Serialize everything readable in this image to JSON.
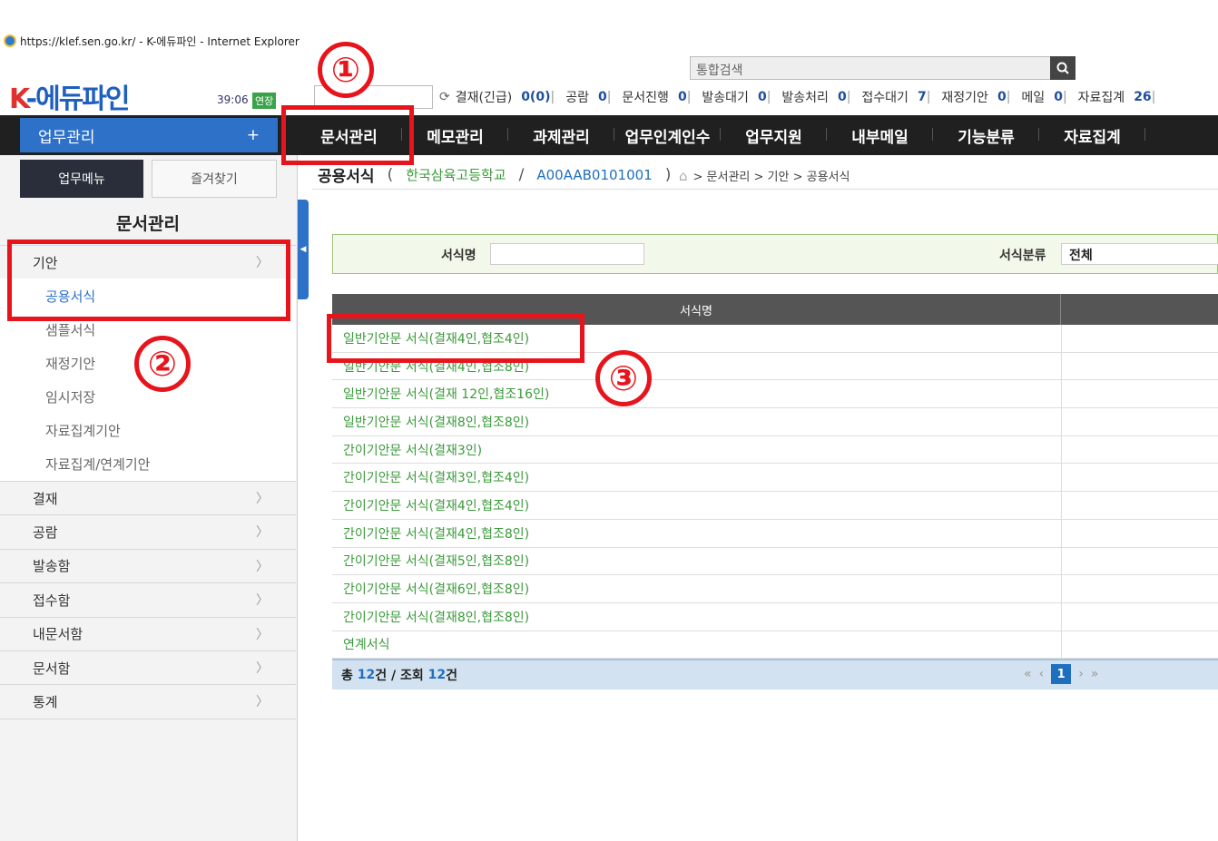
{
  "window": {
    "title": "https://klef.sen.go.kr/ - K-에듀파인 - Internet Explorer"
  },
  "header": {
    "logo": "K-에듀파인",
    "logo_k": "K",
    "logo_rest": "-에듀파인",
    "clock": "39:06",
    "extend_label": "연장",
    "search_placeholder": "통합검색",
    "status": [
      {
        "label": "결재(긴급)",
        "value": "0(0)"
      },
      {
        "label": "공람",
        "value": "0"
      },
      {
        "label": "문서진행",
        "value": "0"
      },
      {
        "label": "발송대기",
        "value": "0"
      },
      {
        "label": "발송처리",
        "value": "0"
      },
      {
        "label": "접수대기",
        "value": "7"
      },
      {
        "label": "재정기안",
        "value": "0"
      },
      {
        "label": "메일",
        "value": "0"
      },
      {
        "label": "자료집계",
        "value": "26"
      }
    ]
  },
  "leftnav": {
    "work_label": "업무관리",
    "plus": "+"
  },
  "topnav": [
    "문서관리",
    "메모관리",
    "과제관리",
    "업무인계인수",
    "업무지원",
    "내부메일",
    "기능분류",
    "자료집계"
  ],
  "sidebar": {
    "tab_menu": "업무메뉴",
    "tab_fav": "즐겨찾기",
    "title": "문서관리",
    "group_open": "기안",
    "sub_items": [
      "공용서식",
      "샘플서식",
      "재정기안",
      "임시저장",
      "자료집계기안",
      "자료집계/연계기안"
    ],
    "groups": [
      "결재",
      "공람",
      "발송함",
      "접수함",
      "내문서함",
      "문서함",
      "통계"
    ]
  },
  "page": {
    "title": "공용서식",
    "open_paren": "(",
    "close_paren": ")",
    "school": "한국삼육고등학교",
    "slash": "/",
    "code": "A00AAB0101001",
    "breadcrumb": "> 문서관리 > 기안 > 공용서식"
  },
  "filter": {
    "name_label": "서식명",
    "name_value": "",
    "category_label": "서식분류",
    "category_value": "전체"
  },
  "table": {
    "header": "서식명",
    "rows": [
      "일반기안문 서식(결재4인,협조4인)",
      "일반기안문 서식(결재4인,협조8인)",
      "일반기안문 서식(결재 12인,협조16인)",
      "일반기안문 서식(결재8인,협조8인)",
      "간이기안문 서식(결재3인)",
      "간이기안문 서식(결재3인,협조4인)",
      "간이기안문 서식(결재4인,협조4인)",
      "간이기안문 서식(결재4인,협조8인)",
      "간이기안문 서식(결재5인,협조8인)",
      "간이기안문 서식(결재6인,협조8인)",
      "간이기안문 서식(결재8인,협조8인)",
      "연계서식"
    ],
    "footer_total_prefix": "총",
    "footer_total": "12",
    "footer_mid": "건 / 조회",
    "footer_view": "12",
    "footer_suffix": "건",
    "pager_current": "1"
  },
  "annotations": [
    "①",
    "②",
    "③"
  ],
  "colors": {
    "accent_blue": "#2d71c8",
    "annotation_red": "#e8141c",
    "link_green": "#3a9a3a"
  }
}
